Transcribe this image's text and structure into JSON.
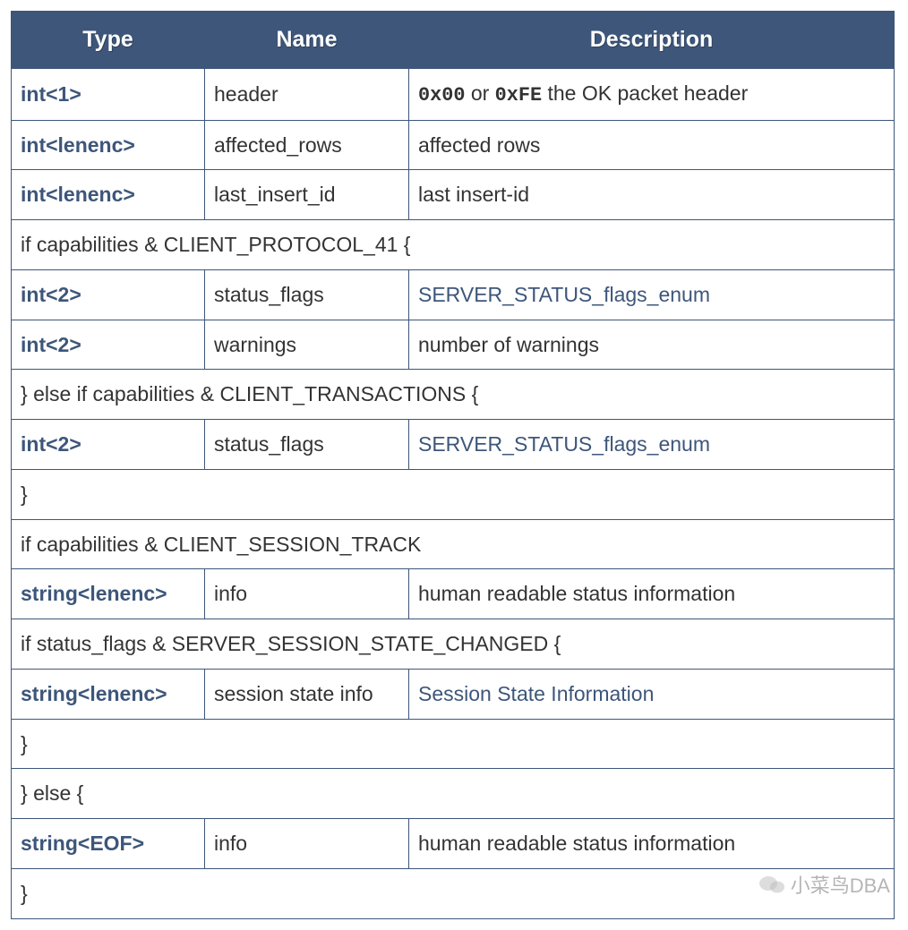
{
  "headers": {
    "type": "Type",
    "name": "Name",
    "desc": "Description"
  },
  "rows": [
    {
      "kind": "field",
      "type": "int<1>",
      "name": "header",
      "desc_parts": [
        {
          "t": "code",
          "v": "0x00"
        },
        {
          "t": "text",
          "v": " or "
        },
        {
          "t": "code",
          "v": "0xFE"
        },
        {
          "t": "text",
          "v": " the OK packet header"
        }
      ]
    },
    {
      "kind": "field",
      "type": "int<lenenc>",
      "name": "affected_rows",
      "desc_parts": [
        {
          "t": "text",
          "v": "affected rows"
        }
      ]
    },
    {
      "kind": "field",
      "type": "int<lenenc>",
      "name": "last_insert_id",
      "desc_parts": [
        {
          "t": "text",
          "v": "last insert-id"
        }
      ]
    },
    {
      "kind": "span",
      "text": "if capabilities & CLIENT_PROTOCOL_41 {"
    },
    {
      "kind": "field",
      "type": "int<2>",
      "name": "status_flags",
      "desc_parts": [
        {
          "t": "link",
          "v": "SERVER_STATUS_flags_enum"
        }
      ]
    },
    {
      "kind": "field",
      "type": "int<2>",
      "name": "warnings",
      "desc_parts": [
        {
          "t": "text",
          "v": "number of warnings"
        }
      ]
    },
    {
      "kind": "span",
      "text": "} else if capabilities & CLIENT_TRANSACTIONS {"
    },
    {
      "kind": "field",
      "type": "int<2>",
      "name": "status_flags",
      "desc_parts": [
        {
          "t": "link",
          "v": "SERVER_STATUS_flags_enum"
        }
      ]
    },
    {
      "kind": "span",
      "text": "}"
    },
    {
      "kind": "span",
      "text": "if capabilities & CLIENT_SESSION_TRACK"
    },
    {
      "kind": "field",
      "type": "string<lenenc>",
      "name": "info",
      "desc_parts": [
        {
          "t": "text",
          "v": "human readable status information"
        }
      ]
    },
    {
      "kind": "span",
      "text": "if status_flags & SERVER_SESSION_STATE_CHANGED {"
    },
    {
      "kind": "field",
      "type": "string<lenenc>",
      "name": "session state info",
      "desc_parts": [
        {
          "t": "link",
          "v": "Session State Information"
        }
      ]
    },
    {
      "kind": "span",
      "text": "}"
    },
    {
      "kind": "span",
      "text": "} else {"
    },
    {
      "kind": "field",
      "type": "string<EOF>",
      "name": "info",
      "desc_parts": [
        {
          "t": "text",
          "v": "human readable status information"
        }
      ]
    },
    {
      "kind": "span",
      "text": "}"
    }
  ],
  "watermark": "小菜鸟DBA"
}
